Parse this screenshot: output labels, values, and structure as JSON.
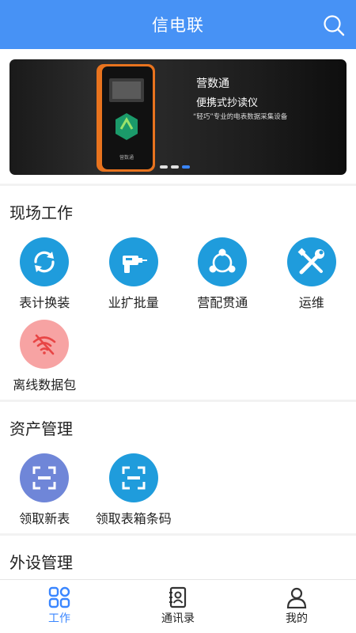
{
  "header": {
    "title": "信电联"
  },
  "banner": {
    "title": "营数通",
    "subtitle": "便携式抄读仪",
    "description": "“轻巧”专业的电表数据采集设备",
    "device_brand": "营数通",
    "active_dot": 2
  },
  "sections": [
    {
      "title": "现场工作",
      "items": [
        {
          "label": "表计换装",
          "icon": "sync-icon"
        },
        {
          "label": "业扩批量",
          "icon": "drill-icon"
        },
        {
          "label": "营配贯通",
          "icon": "share-icon"
        },
        {
          "label": "运维",
          "icon": "tools-icon"
        },
        {
          "label": "离线数据包",
          "icon": "wifi-off-icon"
        }
      ]
    },
    {
      "title": "资产管理",
      "items": [
        {
          "label": "领取新表",
          "icon": "scan-icon"
        },
        {
          "label": "领取表箱条码",
          "icon": "scan-icon"
        }
      ]
    },
    {
      "title": "外设管理"
    }
  ],
  "tabbar": [
    {
      "label": "工作",
      "icon": "grid-icon",
      "active": true
    },
    {
      "label": "通讯录",
      "icon": "contacts-icon",
      "active": false
    },
    {
      "label": "我的",
      "icon": "user-icon",
      "active": false
    }
  ],
  "colors": {
    "primary": "#4792f5",
    "icon_blue": "#1f9cdc",
    "icon_red": "#f7a3a3",
    "icon_purple": "#6f86d8",
    "active_tab": "#3a86ff"
  }
}
